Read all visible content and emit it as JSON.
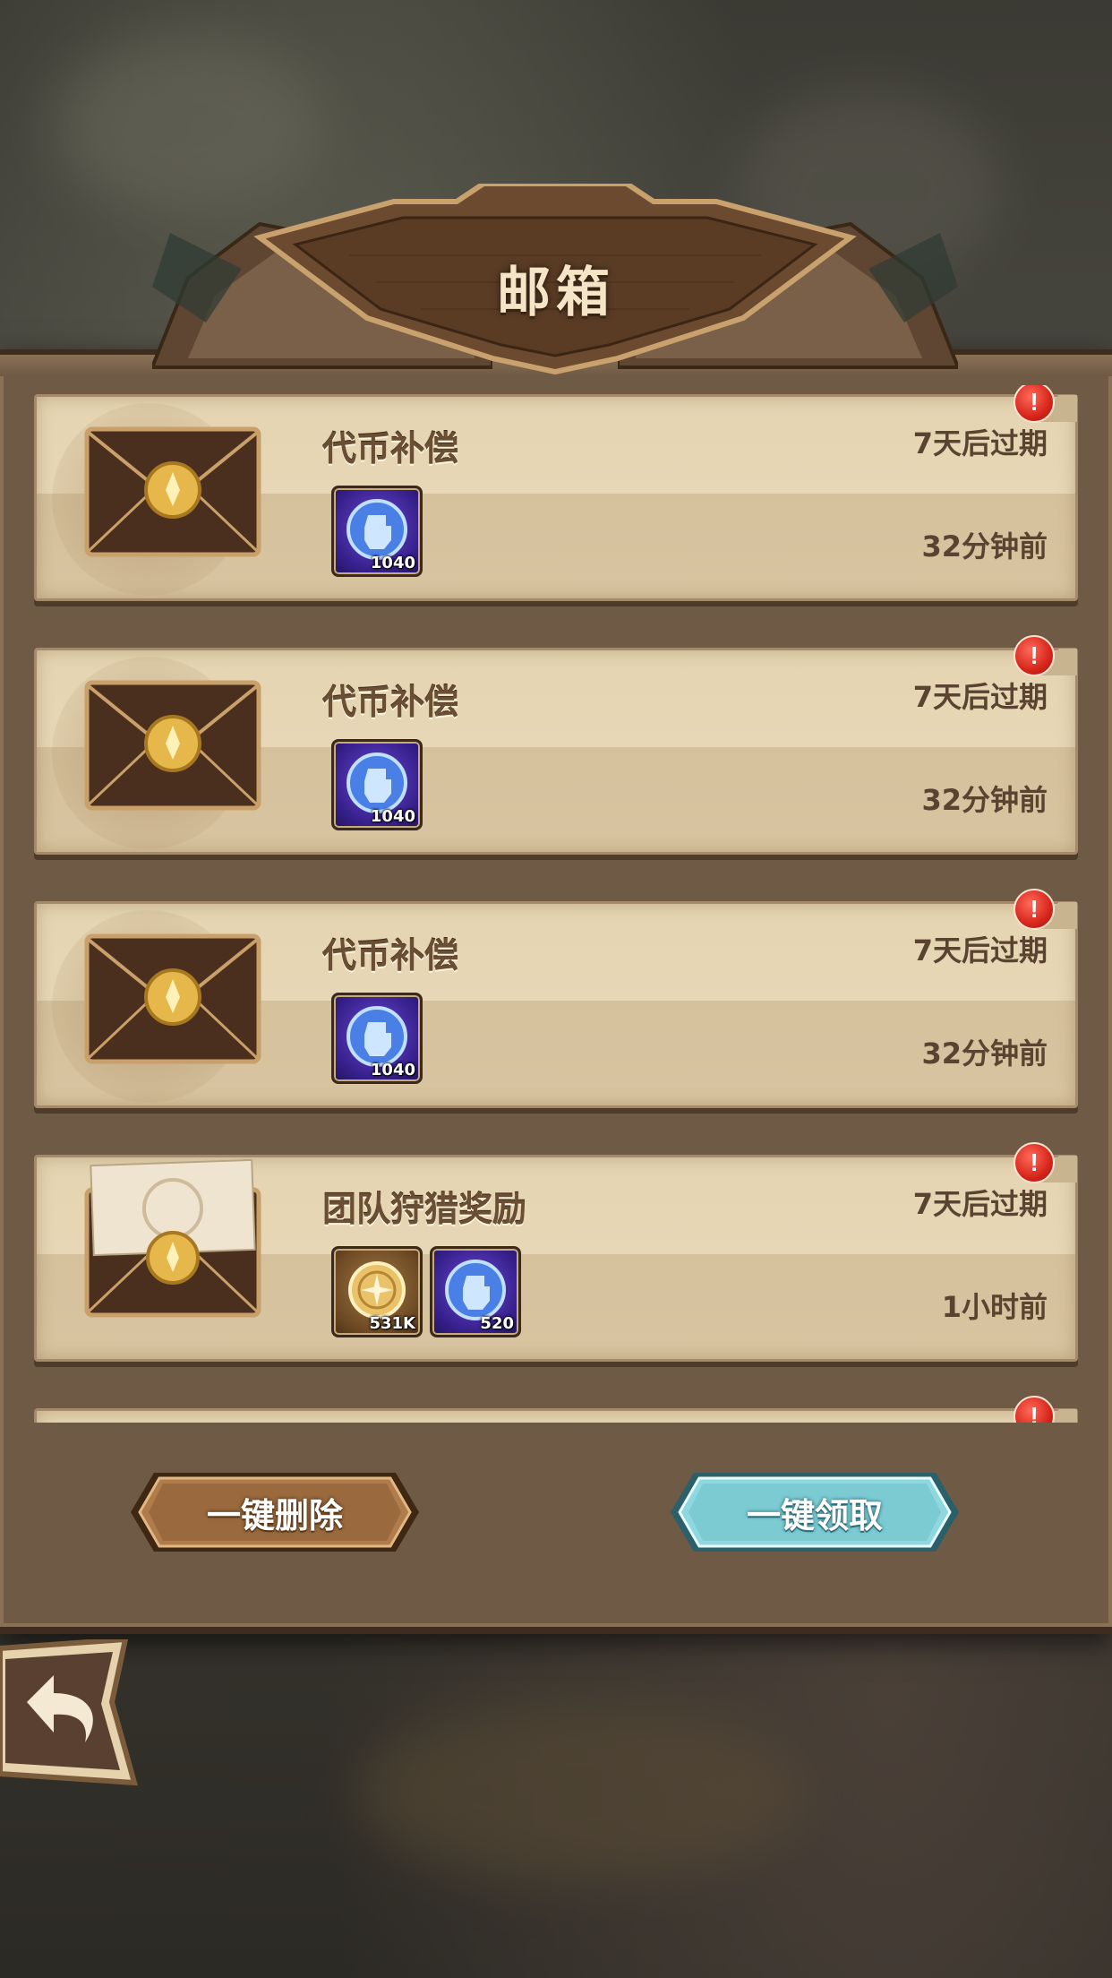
{
  "header": {
    "title": "邮箱"
  },
  "mails": [
    {
      "title": "代币补偿",
      "expires": "7天后过期",
      "time": "32分钟前",
      "unread": true,
      "opened": false,
      "rewards": [
        {
          "icon": "blue-fist-token-icon",
          "type": "purple",
          "qty": "1040"
        }
      ]
    },
    {
      "title": "代币补偿",
      "expires": "7天后过期",
      "time": "32分钟前",
      "unread": true,
      "opened": false,
      "rewards": [
        {
          "icon": "blue-fist-token-icon",
          "type": "purple",
          "qty": "1040"
        }
      ]
    },
    {
      "title": "代币补偿",
      "expires": "7天后过期",
      "time": "32分钟前",
      "unread": true,
      "opened": false,
      "rewards": [
        {
          "icon": "blue-fist-token-icon",
          "type": "purple",
          "qty": "1040"
        }
      ]
    },
    {
      "title": "团队狩猎奖励",
      "expires": "7天后过期",
      "time": "1小时前",
      "unread": true,
      "opened": true,
      "rewards": [
        {
          "icon": "gold-coin-icon",
          "type": "gold",
          "qty": "531K"
        },
        {
          "icon": "blue-fist-token-icon",
          "type": "purple",
          "qty": "520"
        }
      ]
    }
  ],
  "footer": {
    "delete_all_label": "一键删除",
    "claim_all_label": "一键领取"
  },
  "alert_glyph": "!",
  "colors": {
    "parchment": "#e5d4b1",
    "frame": "#6f5a45",
    "claim_button": "#8fd8df",
    "delete_button": "#a8764a",
    "alert": "#d7261b"
  }
}
